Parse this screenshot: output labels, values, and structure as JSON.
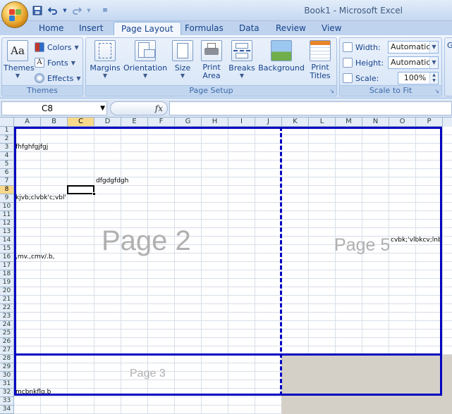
{
  "app": {
    "title": "Book1 - Microsoft Excel"
  },
  "colors": {
    "pagebreak": "#0000c0",
    "ribbon_text": "#15428b",
    "selected_header": "#f8d88a"
  },
  "qat": {
    "save_icon": "save-icon",
    "undo_icon": "undo-icon",
    "redo_icon": "redo-icon",
    "customize_icon": "customize-icon"
  },
  "tabs": [
    {
      "label": "Home"
    },
    {
      "label": "Insert"
    },
    {
      "label": "Page Layout",
      "active": true
    },
    {
      "label": "Formulas"
    },
    {
      "label": "Data"
    },
    {
      "label": "Review"
    },
    {
      "label": "View"
    }
  ],
  "ribbon": {
    "themes": {
      "group_label": "Themes",
      "themes_label": "Themes",
      "colors_label": "Colors",
      "fonts_label": "Fonts",
      "effects_label": "Effects"
    },
    "page_setup": {
      "group_label": "Page Setup",
      "margins_label": "Margins",
      "orientation_label": "Orientation",
      "size_label": "Size",
      "print_area_label": "Print\nArea",
      "breaks_label": "Breaks",
      "background_label": "Background",
      "print_titles_label": "Print\nTitles"
    },
    "scale_to_fit": {
      "group_label": "Scale to Fit",
      "width_label": "Width:",
      "width_value": "Automatic",
      "height_label": "Height:",
      "height_value": "Automatic",
      "scale_label": "Scale:",
      "scale_value": "100%"
    },
    "next_group_fragment": "G"
  },
  "formula_bar": {
    "name_box": "C8",
    "fx_label": "fx",
    "formula": ""
  },
  "columns": [
    "A",
    "B",
    "C",
    "D",
    "E",
    "F",
    "G",
    "H",
    "I",
    "J",
    "K",
    "L",
    "M",
    "N",
    "O",
    "P"
  ],
  "selected_column": "C",
  "rows": [
    "1",
    "2",
    "3",
    "4",
    "5",
    "6",
    "7",
    "8",
    "9",
    "10",
    "11",
    "12",
    "13",
    "14",
    "15",
    "16",
    "17",
    "18",
    "19",
    "20",
    "21",
    "22",
    "23",
    "24",
    "25",
    "26",
    "27",
    "28",
    "29",
    "30",
    "31",
    "32",
    "33",
    "34"
  ],
  "selected_row": "8",
  "cells": [
    {
      "ref": "A3",
      "text": "fhfghfgjfgj"
    },
    {
      "ref": "D7",
      "text": "dfgdgfdgh"
    },
    {
      "ref": "A9",
      "text": "kjvb;clvbk'c;vbl'"
    },
    {
      "ref": "A16",
      "text": ",mv.,cmv/.b,"
    },
    {
      "ref": "N14",
      "text": "cvbk;'vlbkcv;lnb"
    },
    {
      "ref": "A32",
      "text": "mcbnkflg.b"
    }
  ],
  "page_labels": [
    "Page 2",
    "Page 5",
    "Page 3"
  ]
}
